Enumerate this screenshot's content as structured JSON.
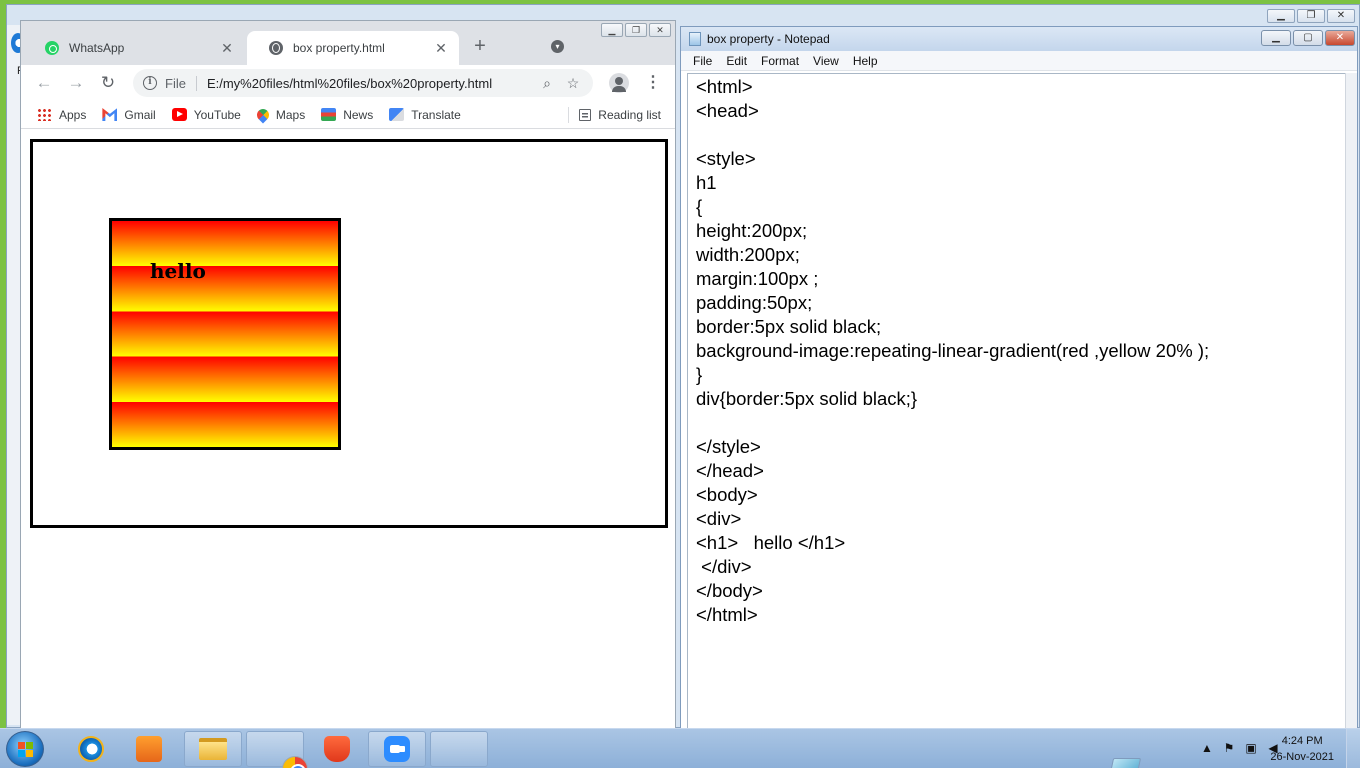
{
  "chrome": {
    "tabs": [
      {
        "title": "WhatsApp",
        "active": false,
        "icon": "whatsapp-icon"
      },
      {
        "title": "box property.html",
        "active": true,
        "icon": "globe-icon"
      }
    ],
    "new_tab_label": "+",
    "address": {
      "scheme_label": "File",
      "url": "E:/my%20files/html%20files/box%20property.html"
    },
    "bookmarks": [
      {
        "label": "Apps",
        "icon": "apps-grid-icon"
      },
      {
        "label": "Gmail",
        "icon": "gmail-icon"
      },
      {
        "label": "YouTube",
        "icon": "youtube-icon"
      },
      {
        "label": "Maps",
        "icon": "maps-icon"
      },
      {
        "label": "News",
        "icon": "news-icon"
      },
      {
        "label": "Translate",
        "icon": "translate-icon"
      }
    ],
    "reading_list_label": "Reading list",
    "page": {
      "heading_text": "hello",
      "gradient_colors": [
        "#ff0000",
        "#ffff00"
      ]
    }
  },
  "notepad": {
    "title": "box property - Notepad",
    "menus": [
      "File",
      "Edit",
      "Format",
      "View",
      "Help"
    ],
    "lines": [
      "<html>",
      "<head>",
      "",
      "<style>",
      "h1",
      "{",
      "height:200px;",
      "width:200px;",
      "margin:100px ;",
      "padding:50px;",
      "border:5px solid black;",
      "background-image:repeating-linear-gradient(red ,yellow 20% );",
      "}",
      "div{border:5px solid black;}",
      "",
      "</style>",
      "</head>",
      "<body>",
      "<div>",
      "<h1>   hello </h1>",
      " </div>",
      "</body>",
      "</html>"
    ]
  },
  "taskbar": {
    "items": [
      "internet-explorer-icon",
      "media-player-icon",
      "file-explorer-icon",
      "chrome-icon",
      "brave-icon",
      "zoom-icon",
      "notepad-icon"
    ],
    "clock": {
      "time": "4:24 PM",
      "date": "26-Nov-2021"
    }
  },
  "colors": {
    "desktop_green": "#7cc243",
    "taskbar_blue": "#9bb9dc"
  }
}
